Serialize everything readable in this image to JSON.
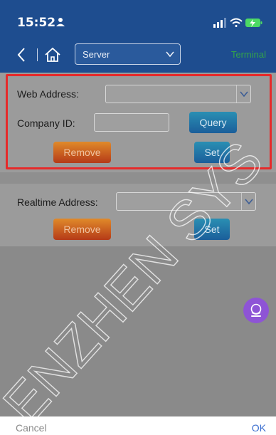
{
  "status": {
    "time": "15:52"
  },
  "nav": {
    "server_value": "Server",
    "terminal_label": "Terminal"
  },
  "panel1": {
    "web_address_label": "Web Address:",
    "company_id_label": "Company ID:",
    "query_label": "Query",
    "remove_label": "Remove",
    "set_label": "Set"
  },
  "panel2": {
    "realtime_label": "Realtime Address:",
    "remove_label": "Remove",
    "set_label": "Set"
  },
  "footer": {
    "cancel_label": "Cancel",
    "ok_label": "OK"
  },
  "watermark": {
    "text": "ENZHEN SYS"
  },
  "colors": {
    "nav_bg": "#1e4d8f",
    "highlight": "#e62a2a",
    "ok": "#3b6fd0",
    "fab": "#8e54d6"
  },
  "icons": [
    "person-icon",
    "signal-icon",
    "wifi-icon",
    "battery-charging-icon",
    "back-chevron-icon",
    "home-icon",
    "chevron-down-icon",
    "fab-icon"
  ]
}
